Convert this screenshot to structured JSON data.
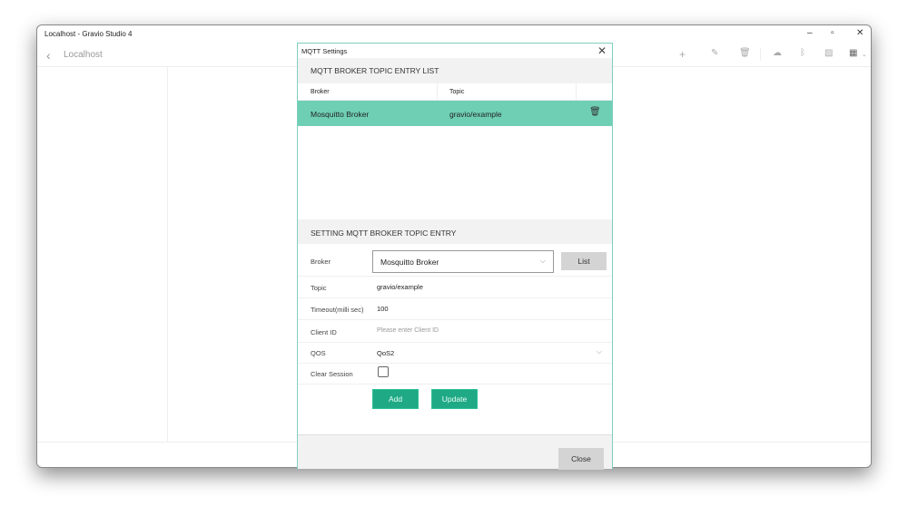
{
  "window": {
    "title": "Localhost - Gravio Studio 4",
    "breadcrumb": "Localhost"
  },
  "dialog": {
    "title": "MQTT Settings",
    "list_header": "MQTT BROKER TOPIC ENTRY LIST",
    "columns": [
      "Broker",
      "Topic"
    ],
    "rows": [
      {
        "broker": "Mosquitto Broker",
        "topic": "gravio/example"
      }
    ],
    "setting_header": "SETTING MQTT BROKER TOPIC ENTRY",
    "fields": {
      "broker_label": "Broker",
      "broker_value": "Mosquitto Broker",
      "list_button": "List",
      "topic_label": "Topic",
      "topic_value": "gravio/example",
      "timeout_label": "Timeout(milli sec)",
      "timeout_value": "100",
      "client_label": "Client ID",
      "client_placeholder": "Please enter Client ID",
      "qos_label": "QOS",
      "qos_value": "QoS2",
      "clear_label": "Clear Session",
      "clear_checked": false
    },
    "add_button": "Add",
    "update_button": "Update",
    "close_button": "Close"
  },
  "colors": {
    "accent": "#1fa985",
    "selected_row": "#6fcfb5"
  }
}
